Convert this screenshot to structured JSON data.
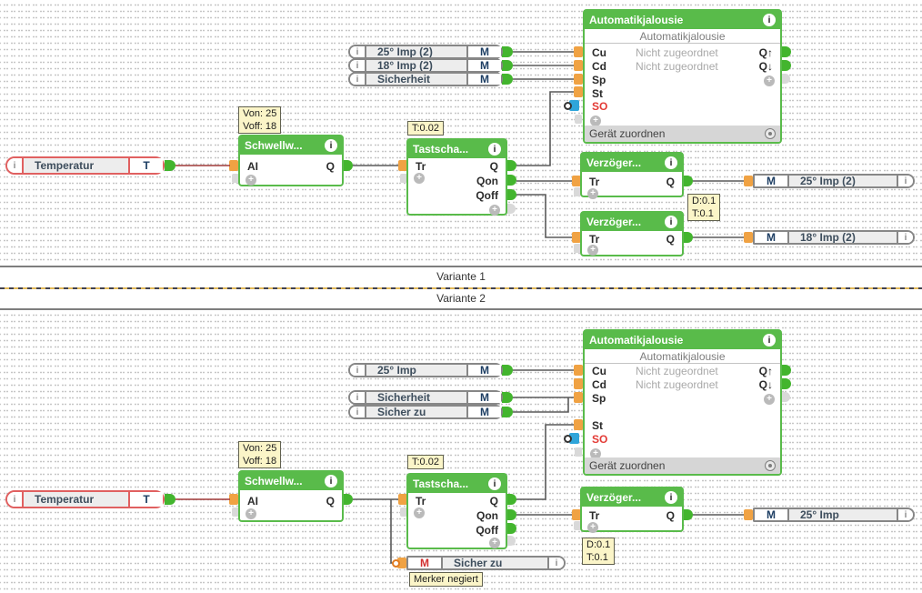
{
  "icons": {
    "info": "i",
    "node_info": "i",
    "plus": "+"
  },
  "separator": {
    "label1": "Variante 1",
    "label2": "Variante 2"
  },
  "v1": {
    "temperatur": {
      "label": "Temperatur",
      "port": "T"
    },
    "inputs": [
      {
        "label": "25° Imp (2)",
        "port": "M"
      },
      {
        "label": "18° Imp (2)",
        "port": "M"
      },
      {
        "label": "Sicherheit",
        "port": "M"
      }
    ],
    "threshold": {
      "note1": "Von: 25",
      "note2": "Voff: 18",
      "title": "Schwellw...",
      "in1": "AI",
      "out1": "Q"
    },
    "pushbutton": {
      "note1": "T:0.02",
      "title": "Tastscha...",
      "in1": "Tr",
      "out1": "Q",
      "out2": "Qon",
      "out3": "Qoff"
    },
    "shutter": {
      "title": "Automatikjalousie",
      "subtitle": "Automatikjalousie",
      "in1": "Cu",
      "in2": "Cd",
      "in3": "Sp",
      "in4": "St",
      "in5": "SO",
      "assign1": "Nicht zugeordnet",
      "assign2": "Nicht zugeordnet",
      "out1": "Q↑",
      "out2": "Q↓",
      "footer": "Gerät zuordnen"
    },
    "delay1": {
      "title": "Verzöger...",
      "in1": "Tr",
      "out1": "Q"
    },
    "delay2": {
      "title": "Verzöger...",
      "in1": "Tr",
      "out1": "Q"
    },
    "delay_note": {
      "line1": "D:0.1",
      "line2": "T:0.1"
    },
    "outputs": [
      {
        "port": "M",
        "label": "25° Imp (2)"
      },
      {
        "port": "M",
        "label": "18° Imp (2)"
      }
    ]
  },
  "v2": {
    "temperatur": {
      "label": "Temperatur",
      "port": "T"
    },
    "inputs": [
      {
        "label": "25° Imp",
        "port": "M"
      },
      {
        "label": "Sicherheit",
        "port": "M"
      },
      {
        "label": "Sicher zu",
        "port": "M"
      }
    ],
    "threshold": {
      "note1": "Von: 25",
      "note2": "Voff: 18",
      "title": "Schwellw...",
      "in1": "AI",
      "out1": "Q"
    },
    "pushbutton": {
      "note1": "T:0.02",
      "title": "Tastscha...",
      "in1": "Tr",
      "out1": "Q",
      "out2": "Qon",
      "out3": "Qoff"
    },
    "shutter": {
      "title": "Automatikjalousie",
      "subtitle": "Automatikjalousie",
      "in1": "Cu",
      "in2": "Cd",
      "in3": "Sp",
      "in4": "St",
      "in5": "SO",
      "assign1": "Nicht zugeordnet",
      "assign2": "Nicht zugeordnet",
      "out1": "Q↑",
      "out2": "Q↓",
      "footer": "Gerät zuordnen"
    },
    "delay1": {
      "title": "Verzöger...",
      "in1": "Tr",
      "out1": "Q"
    },
    "delay_note": {
      "line1": "D:0.1",
      "line2": "T:0.1"
    },
    "outputs": [
      {
        "port": "M",
        "label": "25° Imp"
      }
    ],
    "merker": {
      "port": "M",
      "label": "Sicher zu",
      "note": "Merker negiert"
    }
  }
}
